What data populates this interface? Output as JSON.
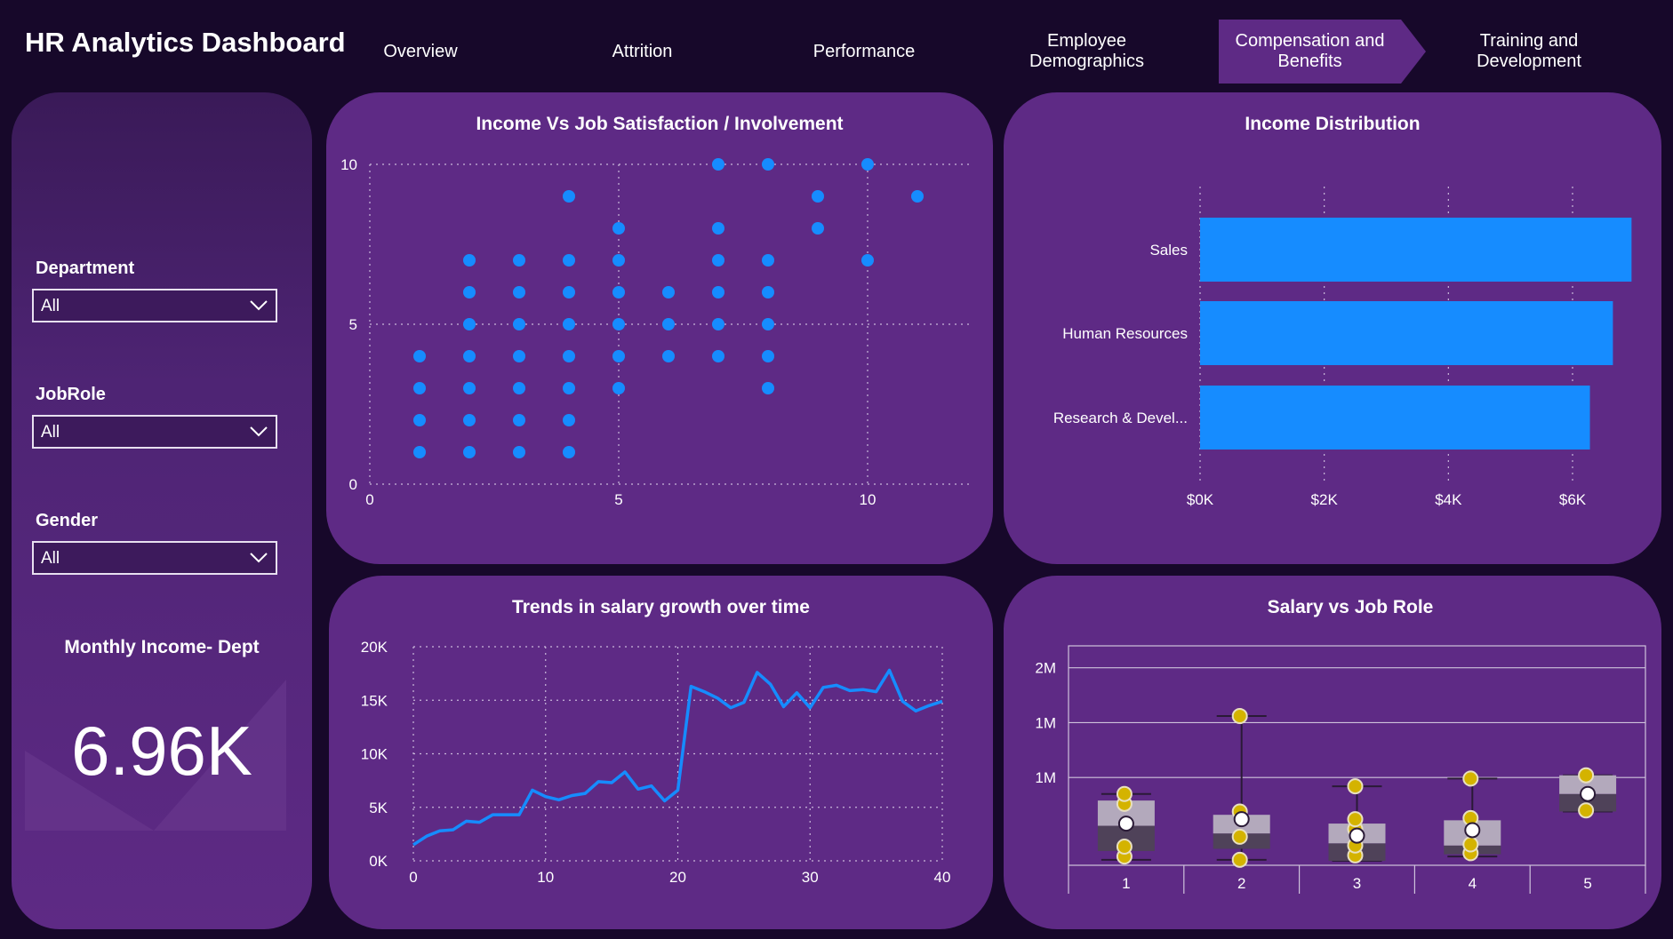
{
  "app_title": "HR Analytics Dashboard",
  "nav": [
    {
      "label": "Overview"
    },
    {
      "label": "Attrition"
    },
    {
      "label": "Performance"
    },
    {
      "label": "Employee Demographics"
    },
    {
      "label": "Compensation and Benefits",
      "active": true
    },
    {
      "label": "Training and Development"
    }
  ],
  "filters": {
    "department": {
      "label": "Department",
      "value": "All"
    },
    "jobrole": {
      "label": "JobRole",
      "value": "All"
    },
    "gender": {
      "label": "Gender",
      "value": "All"
    }
  },
  "kpi": {
    "title": "Monthly Income- Dept",
    "value": "6.96K"
  },
  "colors": {
    "accent": "#168cff",
    "panel": "#5e2a85",
    "background": "#17082a",
    "box_dark": "#4f4259",
    "box_light": "#b3a9bc",
    "marker": "#d4b300"
  },
  "chart_data": [
    {
      "type": "scatter",
      "title": "Income Vs Job Satisfaction / Involvement",
      "xlim": [
        0,
        12
      ],
      "ylim": [
        0,
        10
      ],
      "x_ticks": [
        0,
        5,
        10
      ],
      "y_ticks": [
        0,
        5,
        10
      ],
      "grid": true,
      "points": [
        [
          1,
          1
        ],
        [
          1,
          2
        ],
        [
          1,
          3
        ],
        [
          1,
          4
        ],
        [
          2,
          1
        ],
        [
          2,
          2
        ],
        [
          2,
          3
        ],
        [
          2,
          4
        ],
        [
          2,
          5
        ],
        [
          2,
          6
        ],
        [
          2,
          7
        ],
        [
          3,
          1
        ],
        [
          3,
          2
        ],
        [
          3,
          3
        ],
        [
          3,
          4
        ],
        [
          3,
          5
        ],
        [
          3,
          6
        ],
        [
          3,
          7
        ],
        [
          4,
          1
        ],
        [
          4,
          2
        ],
        [
          4,
          3
        ],
        [
          4,
          4
        ],
        [
          4,
          5
        ],
        [
          4,
          6
        ],
        [
          4,
          7
        ],
        [
          4,
          9
        ],
        [
          5,
          3
        ],
        [
          5,
          4
        ],
        [
          5,
          5
        ],
        [
          5,
          6
        ],
        [
          5,
          7
        ],
        [
          5,
          8
        ],
        [
          6,
          4
        ],
        [
          6,
          5
        ],
        [
          6,
          6
        ],
        [
          7,
          4
        ],
        [
          7,
          5
        ],
        [
          7,
          6
        ],
        [
          7,
          7
        ],
        [
          7,
          8
        ],
        [
          7,
          10
        ],
        [
          8,
          3
        ],
        [
          8,
          4
        ],
        [
          8,
          5
        ],
        [
          8,
          6
        ],
        [
          8,
          7
        ],
        [
          8,
          10
        ],
        [
          9,
          8
        ],
        [
          9,
          9
        ],
        [
          10,
          7
        ],
        [
          10,
          10
        ],
        [
          11,
          9
        ]
      ]
    },
    {
      "type": "bar",
      "orientation": "horizontal",
      "title": "Income Distribution",
      "categories": [
        "Sales",
        "Human Resources",
        "Research & Devel..."
      ],
      "values": [
        6950,
        6650,
        6280
      ],
      "xlim": [
        0,
        7000
      ],
      "x_ticks": [
        "$0K",
        "$2K",
        "$4K",
        "$6K"
      ],
      "x_tick_values": [
        0,
        2000,
        4000,
        6000
      ],
      "grid": true
    },
    {
      "type": "line",
      "title": "Trends in salary growth over time",
      "xlim": [
        0,
        40
      ],
      "ylim": [
        0,
        20000
      ],
      "x_ticks": [
        0,
        10,
        20,
        30,
        40
      ],
      "y_ticks": [
        "0K",
        "5K",
        "10K",
        "15K",
        "20K"
      ],
      "y_tick_values": [
        0,
        5000,
        10000,
        15000,
        20000
      ],
      "grid": true,
      "x": [
        0,
        1,
        2,
        3,
        4,
        5,
        6,
        7,
        8,
        9,
        10,
        11,
        12,
        13,
        14,
        15,
        16,
        17,
        18,
        19,
        20,
        21,
        22,
        23,
        24,
        25,
        26,
        27,
        28,
        29,
        30,
        31,
        32,
        33,
        34,
        35,
        36,
        37,
        38,
        39,
        40
      ],
      "values": [
        1500,
        2300,
        2800,
        2900,
        3700,
        3600,
        4300,
        4300,
        4300,
        6600,
        6000,
        5700,
        6100,
        6300,
        7400,
        7300,
        8300,
        6700,
        7000,
        5600,
        6600,
        16300,
        15800,
        15200,
        14300,
        14800,
        17600,
        16500,
        14400,
        15700,
        14300,
        16200,
        16400,
        15900,
        16000,
        15800,
        17800,
        14900,
        14000,
        14500,
        14900
      ]
    },
    {
      "type": "box",
      "title": "Salary vs Job Role",
      "categories": [
        "1",
        "2",
        "3",
        "4",
        "5"
      ],
      "y_ticks": [
        "2M",
        "1M",
        "1M"
      ],
      "y_tick_values": [
        1.8,
        1.3,
        0.8
      ],
      "ylim": [
        0,
        2.0
      ],
      "boxes": [
        {
          "whisker_min": 0.05,
          "q1": 0.13,
          "median": 0.36,
          "q3": 0.59,
          "whisker_max": 0.65,
          "mean": 0.38,
          "points": [
            0.08,
            0.17,
            0.56,
            0.65
          ]
        },
        {
          "whisker_min": 0.05,
          "q1": 0.15,
          "median": 0.29,
          "q3": 0.46,
          "whisker_max": 1.36,
          "mean": 0.42,
          "points": [
            0.05,
            0.26,
            0.49,
            1.36
          ]
        },
        {
          "whisker_min": 0.04,
          "q1": 0.04,
          "median": 0.2,
          "q3": 0.38,
          "whisker_max": 0.72,
          "mean": 0.27,
          "points": [
            0.09,
            0.18,
            0.33,
            0.42,
            0.72
          ]
        },
        {
          "whisker_min": 0.08,
          "q1": 0.1,
          "median": 0.18,
          "q3": 0.41,
          "whisker_max": 0.79,
          "mean": 0.32,
          "points": [
            0.11,
            0.19,
            0.43,
            0.79
          ]
        },
        {
          "whisker_min": 0.49,
          "q1": 0.49,
          "median": 0.65,
          "q3": 0.82,
          "whisker_max": 0.82,
          "mean": 0.65,
          "points": [
            0.5,
            0.82
          ]
        }
      ]
    }
  ]
}
